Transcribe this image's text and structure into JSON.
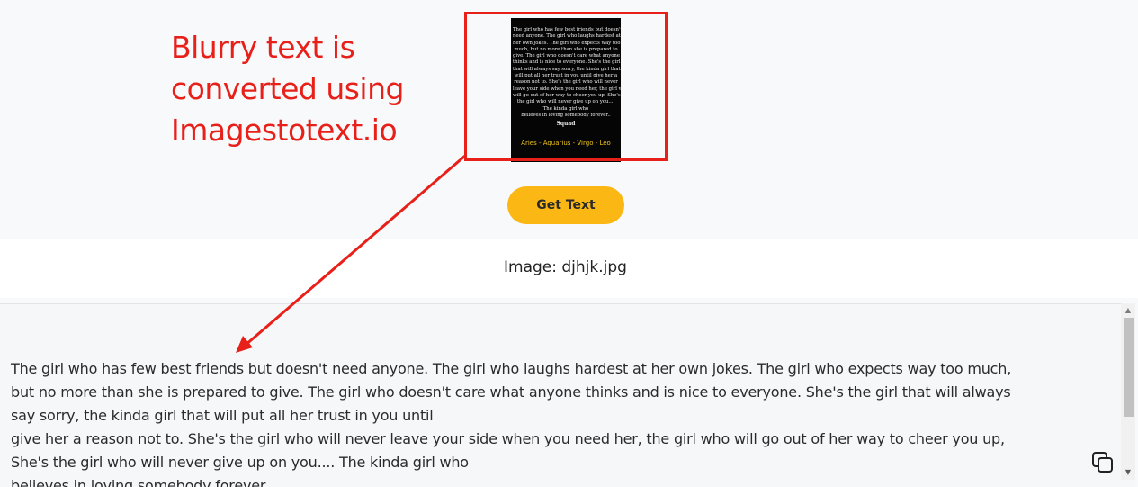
{
  "annotation": {
    "lines": [
      "Blurry text is",
      "converted using",
      "Imagestotext.io"
    ]
  },
  "thumbnail": {
    "lines": [
      "The girl who has few best friends but doesn't",
      "need anyone. The girl who laughs hardest at",
      "her own jokes. The girl who expects way too",
      "much, but no more than she is prepared to",
      "give. The girl who doesn't care what anyone",
      "thinks and is nice to everyone. She's the girl",
      "that will always say sorry, the kinda girl that",
      "will put all her trust in you until give her a",
      "reason not to. She's the girl who will never",
      "leave your side when you need her, the girl who",
      "will go out of her way to cheer you up, She's",
      "the girl who will never give up on you....",
      "The kinda girl who",
      "believes in loving somebody forever.."
    ],
    "signature": "Squad",
    "signs": "Aries - Aquarius - Virgo - Leo"
  },
  "get_text_label": "Get Text",
  "image_name": "Image: djhjk.jpg",
  "result_text": "The girl who has few best friends but doesn't need anyone. The girl who laughs hardest at her own jokes. The girl who expects way too much,\nbut no more than she is prepared to give. The girl who doesn't care what anyone thinks and is nice to everyone. She's the girl that will always\nsay sorry, the kinda girl that will put all her trust in you until\ngive her a reason not to. She's the girl who will never leave your side when you need her, the girl who will go out of her way to cheer you up,\nShe's the girl who will never give up on you.... The kinda girl who\nbelieves in loving somebody forever..",
  "colors": {
    "annotation_red": "#e8201a",
    "button_yellow": "#fbb714",
    "background": "#f8f9fa"
  },
  "icons": {
    "copy": "copy-icon",
    "scroll_up": "scroll-up-icon",
    "scroll_down": "scroll-down-icon"
  }
}
